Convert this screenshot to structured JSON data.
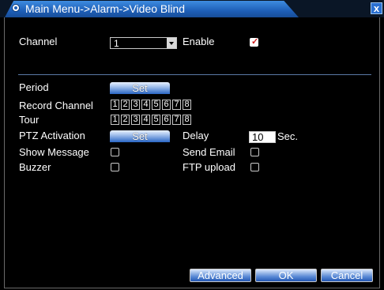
{
  "window": {
    "title": "Main Menu->Alarm->Video Blind",
    "close_icon": "x"
  },
  "form": {
    "channel_label": "Channel",
    "channel_value": "1",
    "enable_label": "Enable",
    "enable_checked": true,
    "period_label": "Period",
    "period_button": "Set",
    "record_channel_label": "Record Channel",
    "record_channels": [
      "1",
      "2",
      "3",
      "4",
      "5",
      "6",
      "7",
      "8"
    ],
    "tour_label": "Tour",
    "tour_channels": [
      "1",
      "2",
      "3",
      "4",
      "5",
      "6",
      "7",
      "8"
    ],
    "ptz_label": "PTZ Activation",
    "ptz_button": "Set",
    "delay_label": "Delay",
    "delay_value": "10",
    "delay_unit": "Sec.",
    "show_message_label": "Show Message",
    "show_message_checked": false,
    "send_email_label": "Send Email",
    "send_email_checked": false,
    "buzzer_label": "Buzzer",
    "buzzer_checked": false,
    "ftp_upload_label": "FTP upload",
    "ftp_upload_checked": false
  },
  "footer": {
    "advanced_button": "Advanced",
    "ok_button": "OK",
    "cancel_button": "Cancel"
  }
}
